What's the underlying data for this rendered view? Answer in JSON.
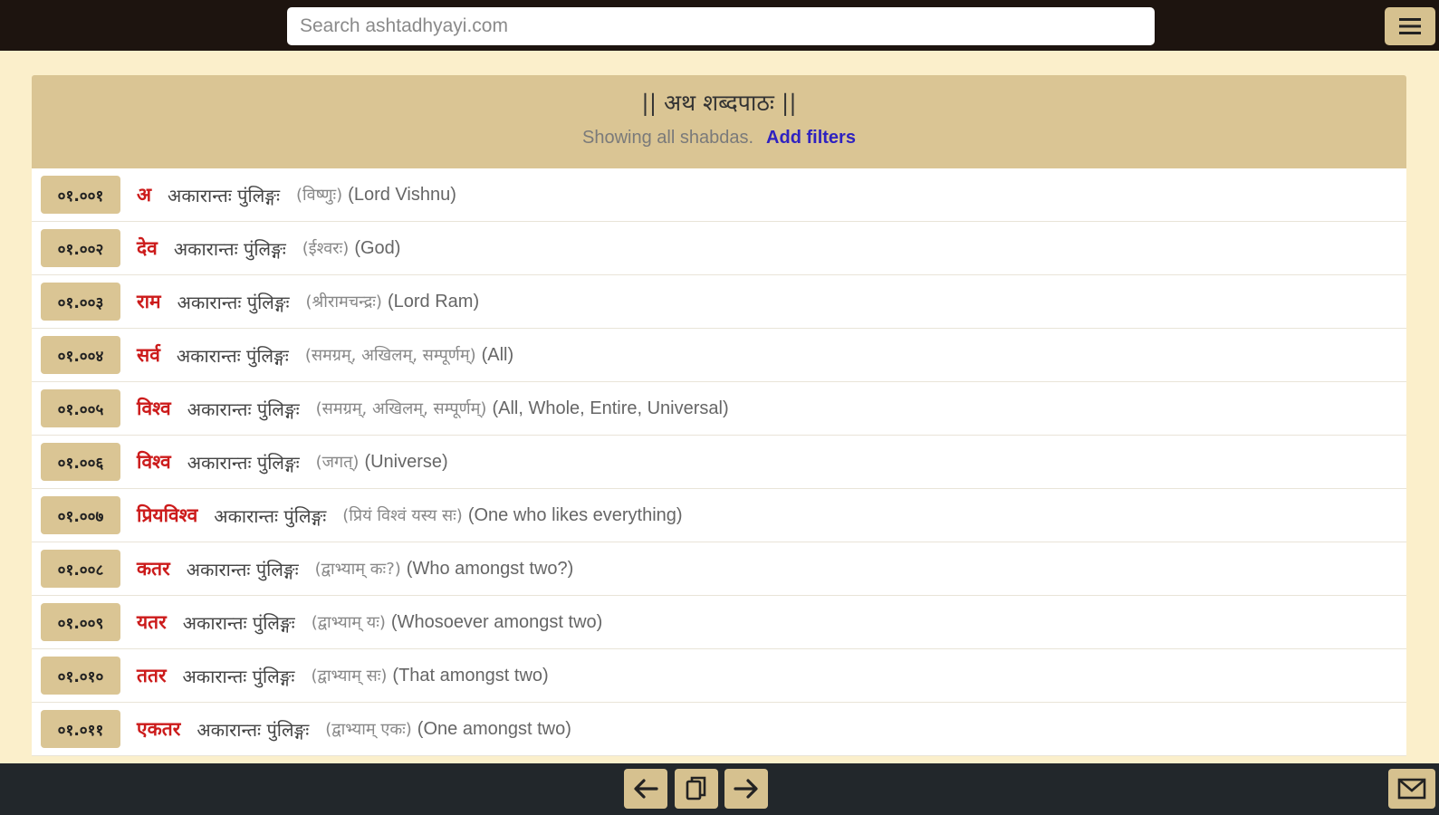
{
  "search": {
    "placeholder": "Search ashtadhyayi.com"
  },
  "header": {
    "title": "|| अथ शब्दपाठः ||",
    "subtitle": "Showing all shabdas.",
    "filter_link": "Add filters"
  },
  "rows": [
    {
      "id": "०१.००१",
      "word": "अ",
      "grammar": "अकारान्तः पुंलिङ्गः",
      "gloss": "(विष्णुः)",
      "english": "(Lord Vishnu)"
    },
    {
      "id": "०१.००२",
      "word": "देव",
      "grammar": "अकारान्तः पुंलिङ्गः",
      "gloss": "(ईश्वरः)",
      "english": "(God)"
    },
    {
      "id": "०१.००३",
      "word": "राम",
      "grammar": "अकारान्तः पुंलिङ्गः",
      "gloss": "(श्रीरामचन्द्रः)",
      "english": "(Lord Ram)"
    },
    {
      "id": "०१.००४",
      "word": "सर्व",
      "grammar": "अकारान्तः पुंलिङ्गः",
      "gloss": "(समग्रम्, अखिलम्, सम्पूर्णम्)",
      "english": "(All)"
    },
    {
      "id": "०१.००५",
      "word": "विश्व",
      "grammar": "अकारान्तः पुंलिङ्गः",
      "gloss": "(समग्रम्, अखिलम्, सम्पूर्णम्)",
      "english": "(All, Whole, Entire, Universal)"
    },
    {
      "id": "०१.००६",
      "word": "विश्व",
      "grammar": "अकारान्तः पुंलिङ्गः",
      "gloss": "(जगत्)",
      "english": "(Universe)"
    },
    {
      "id": "०१.००७",
      "word": "प्रियविश्व",
      "grammar": "अकारान्तः पुंलिङ्गः",
      "gloss": "(प्रियं विश्वं यस्य सः)",
      "english": "(One who likes everything)"
    },
    {
      "id": "०१.००८",
      "word": "कतर",
      "grammar": "अकारान्तः पुंलिङ्गः",
      "gloss": "(द्वाभ्याम् कः?)",
      "english": "(Who amongst two?)"
    },
    {
      "id": "०१.००९",
      "word": "यतर",
      "grammar": "अकारान्तः पुंलिङ्गः",
      "gloss": "(द्वाभ्याम् यः)",
      "english": "(Whosoever amongst two)"
    },
    {
      "id": "०१.०१०",
      "word": "ततर",
      "grammar": "अकारान्तः पुंलिङ्गः",
      "gloss": "(द्वाभ्याम् सः)",
      "english": "(That amongst two)"
    },
    {
      "id": "०१.०११",
      "word": "एकतर",
      "grammar": "अकारान्तः पुंलिङ्गः",
      "gloss": "(द्वाभ्याम् एकः)",
      "english": "(One amongst two)"
    }
  ],
  "icons": {
    "menu": "hamburger-menu-icon",
    "prev": "arrow-left-icon",
    "copy": "copy-icon",
    "next": "arrow-right-icon",
    "mail": "mail-icon"
  }
}
